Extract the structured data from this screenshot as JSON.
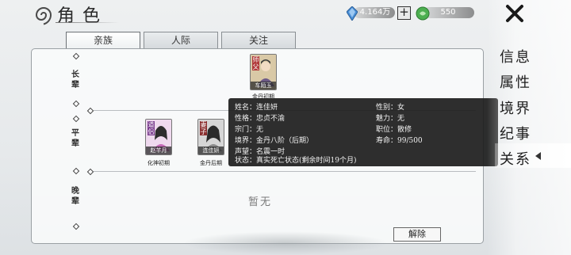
{
  "header": {
    "title": "角色"
  },
  "currency": {
    "gem_amount": "4.164万",
    "plus_label": "+",
    "jade_amount": "550"
  },
  "tabs": [
    {
      "label": "亲族",
      "active": true
    },
    {
      "label": "人际",
      "active": false
    },
    {
      "label": "关注",
      "active": false
    }
  ],
  "sidebar": {
    "items": [
      {
        "label": "信息"
      },
      {
        "label": "属性"
      },
      {
        "label": "境界"
      },
      {
        "label": "纪事"
      },
      {
        "label": "关系",
        "active": true
      }
    ]
  },
  "rows": [
    {
      "label": "长辈"
    },
    {
      "label": "平辈"
    },
    {
      "label": "晚辈"
    }
  ],
  "elder": {
    "tag": "师父",
    "name": "车陌玉",
    "realm": "金丹初期"
  },
  "peers": [
    {
      "tag": "道侣",
      "name": "赵芊月",
      "realm": "化神初期"
    },
    {
      "tag": "妻子",
      "name": "连佳妍",
      "realm": "金丹后期"
    }
  ],
  "tooltip": {
    "name": "姓名：连佳妍",
    "gender": "性别：女",
    "personality": "性格：忠贞不渝",
    "charm": "魅力：无",
    "sect": "宗门：无",
    "position": "职位：散修",
    "realm": "境界：金丹八阶（后期）",
    "lifespan": "寿命：99/500",
    "reputation": "声望：名震一时",
    "status": "状态：真实死亡状态(剩余时间19个月)"
  },
  "empty_label": "暂无",
  "release_label": "解除",
  "colors": {
    "tooltip_bg": "#1c1c1c",
    "tag_red": "#b13a3a",
    "tag_purple": "#7a3b8e",
    "gem_blue": "#4a8fd6",
    "jade_green": "#4caf50"
  }
}
